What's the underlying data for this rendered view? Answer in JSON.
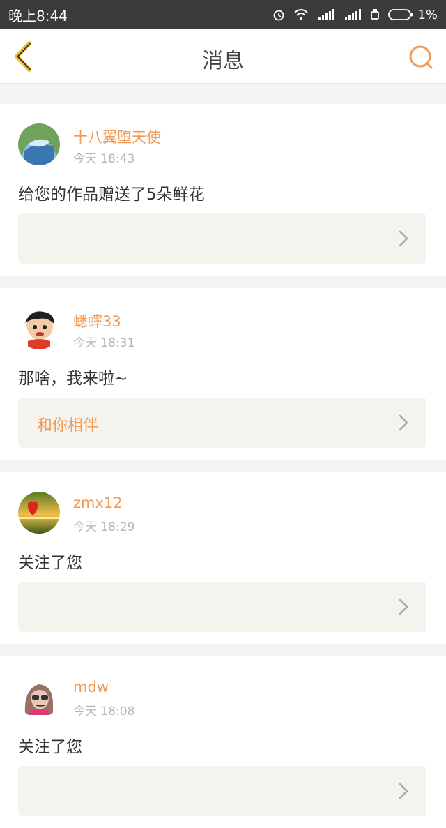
{
  "status_bar": {
    "time": "晚上8:44",
    "battery": "1%",
    "icons": [
      "alarm-icon",
      "wifi-icon",
      "signal-icon",
      "signal-icon",
      "usb-icon",
      "battery-icon"
    ]
  },
  "header": {
    "title": "消息",
    "back_icon": "back-chevron-icon",
    "search_icon": "search-icon",
    "accent_color": "#ef9a56"
  },
  "messages": [
    {
      "username": "十八翼堕天使",
      "time": "今天 18:43",
      "text": "给您的作品赠送了5朵鲜花",
      "quote": ""
    },
    {
      "username": "蟋蟀33",
      "time": "今天 18:31",
      "text": "那啥，我来啦~",
      "quote": "和你相伴"
    },
    {
      "username": "zmx12",
      "time": "今天 18:29",
      "text": "关注了您",
      "quote": ""
    },
    {
      "username": "mdw",
      "time": "今天 18:08",
      "text": "关注了您",
      "quote": ""
    }
  ]
}
